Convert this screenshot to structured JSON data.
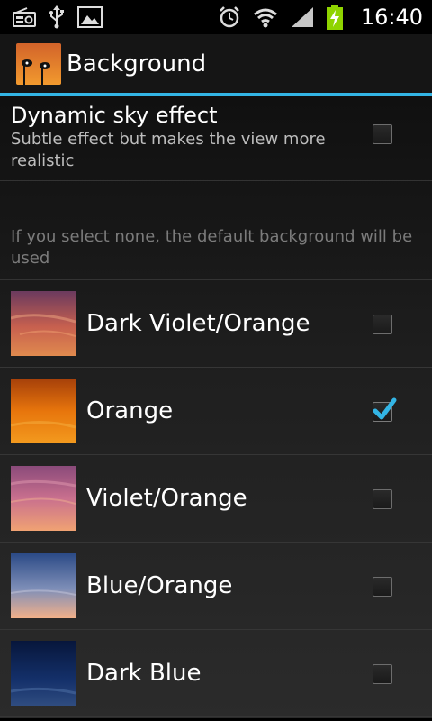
{
  "status_bar": {
    "time": "16:40",
    "icons": [
      "radio-icon",
      "usb-icon",
      "gallery-icon",
      "alarm-icon",
      "wifi-icon",
      "signal-icon",
      "battery-charging-icon"
    ]
  },
  "title_bar": {
    "title": "Background",
    "app_icon": "app-icon"
  },
  "dynamic_sky": {
    "title": "Dynamic sky effect",
    "summary": "Subtle effect but makes the view more realistic",
    "checked": false
  },
  "hint": "If you select none, the default background will be used",
  "backgrounds": [
    {
      "label": "Dark Violet/Orange",
      "checked": false,
      "colors": [
        "#6b3a5e",
        "#c7604f",
        "#e08a4e"
      ]
    },
    {
      "label": "Orange",
      "checked": true,
      "colors": [
        "#a6400a",
        "#e7750c",
        "#f39a1e"
      ]
    },
    {
      "label": "Violet/Orange",
      "checked": false,
      "colors": [
        "#8a4a7a",
        "#c9708e",
        "#f0a273"
      ]
    },
    {
      "label": "Blue/Orange",
      "checked": false,
      "colors": [
        "#2b4a86",
        "#7f8fb8",
        "#f2b08a"
      ]
    },
    {
      "label": "Dark Blue",
      "checked": false,
      "colors": [
        "#07163b",
        "#14306a",
        "#2f4c80"
      ]
    }
  ],
  "colors": {
    "accent": "#33b5e5",
    "check": "#33b5e5"
  }
}
